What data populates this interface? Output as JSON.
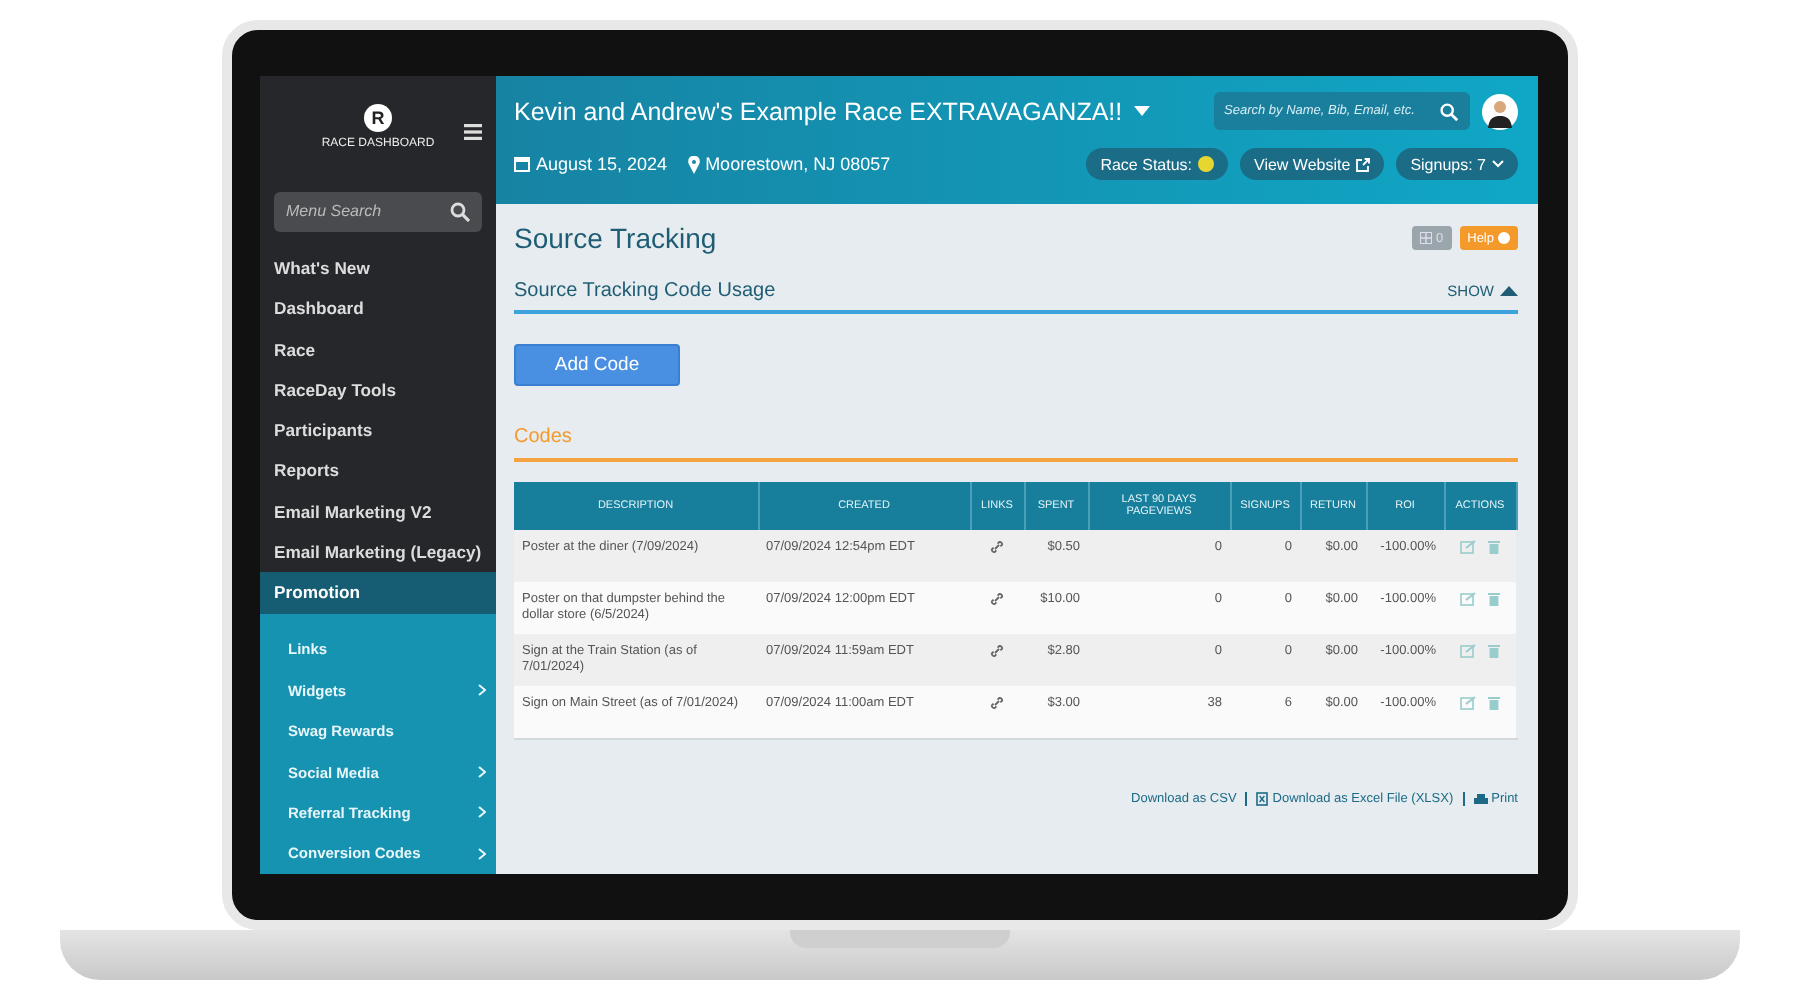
{
  "sidebar": {
    "logo_letter": "R",
    "title": "RACE DASHBOARD",
    "search": {
      "placeholder": "Menu Search"
    },
    "items": [
      {
        "label": "What's New",
        "selected": false
      },
      {
        "label": "Dashboard",
        "selected": false
      },
      {
        "label": "Race",
        "selected": false
      },
      {
        "label": "RaceDay Tools",
        "selected": false
      },
      {
        "label": "Participants",
        "selected": false
      },
      {
        "label": "Reports",
        "selected": false
      },
      {
        "label": "Email Marketing V2",
        "selected": false
      },
      {
        "label": "Email Marketing (Legacy)",
        "selected": false
      },
      {
        "label": "Promotion",
        "selected": true,
        "children": [
          {
            "label": "Links",
            "submenu": false
          },
          {
            "label": "Widgets",
            "submenu": true
          },
          {
            "label": "Swag Rewards",
            "submenu": false
          },
          {
            "label": "Social Media",
            "submenu": true
          },
          {
            "label": "Referral Tracking",
            "submenu": true
          },
          {
            "label": "Conversion Codes",
            "submenu": true
          }
        ]
      }
    ]
  },
  "header": {
    "title": "Kevin and Andrew's Example Race EXTRAVAGANZA!!",
    "date": "August 15, 2024",
    "location": "Moorestown, NJ 08057",
    "search": {
      "placeholder": "Search by Name, Bib, Email, etc."
    },
    "race_status": {
      "label": "Race Status:",
      "color": "#e6d630"
    },
    "view_website": "View Website",
    "signups": "Signups: 7"
  },
  "toolbar": {
    "count": "0",
    "help": "Help"
  },
  "page_title": "Source Tracking",
  "section": {
    "title": "Source Tracking Code Usage",
    "toggle": "SHOW"
  },
  "add_button": "Add Code",
  "codes_heading": "Codes",
  "table": {
    "columns": [
      "DESCRIPTION",
      "CREATED",
      "LINKS",
      "SPENT",
      "LAST 90 DAYS PAGEVIEWS",
      "SIGNUPS",
      "RETURN",
      "ROI",
      "ACTIONS"
    ],
    "rows": [
      {
        "description": "Poster at the diner (7/09/2024)",
        "created": "07/09/2024 12:54pm EDT",
        "spent": "$0.50",
        "pageviews": "0",
        "signups": "0",
        "return": "$0.00",
        "roi": "-100.00%"
      },
      {
        "description": "Poster on that dumpster behind the dollar store (6/5/2024)",
        "created": "07/09/2024 12:00pm EDT",
        "spent": "$10.00",
        "pageviews": "0",
        "signups": "0",
        "return": "$0.00",
        "roi": "-100.00%"
      },
      {
        "description": "Sign at the Train Station (as of 7/01/2024)",
        "created": "07/09/2024 11:59am EDT",
        "spent": "$2.80",
        "pageviews": "0",
        "signups": "0",
        "return": "$0.00",
        "roi": "-100.00%"
      },
      {
        "description": "Sign on Main Street (as of 7/01/2024)",
        "created": "07/09/2024 11:00am EDT",
        "spent": "$3.00",
        "pageviews": "38",
        "signups": "6",
        "return": "$0.00",
        "roi": "-100.00%"
      }
    ]
  },
  "footer_links": [
    "Download as CSV",
    "Download as Excel File (XLSX)",
    "Print"
  ]
}
